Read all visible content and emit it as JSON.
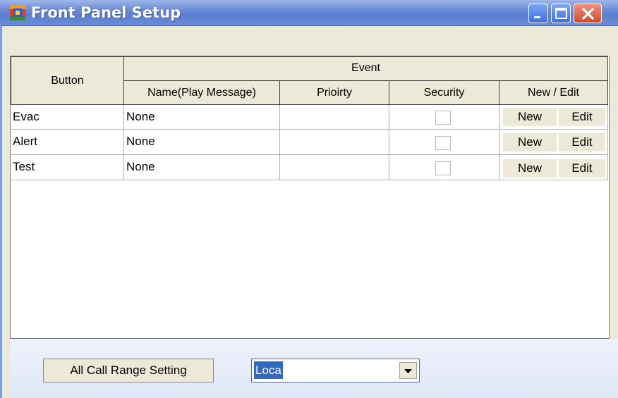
{
  "window": {
    "title": "Front Panel Setup",
    "icon": "app-icon",
    "controls": [
      "minimize-icon",
      "maximize-icon",
      "close-icon"
    ]
  },
  "table": {
    "header": {
      "button": "Button",
      "event": "Event",
      "name": "Name(Play Message)",
      "priority": "Prioirty",
      "security": "Security",
      "new_edit": "New / Edit"
    },
    "rows": [
      {
        "button": "Evac",
        "name": "None",
        "priority": "",
        "security_checked": false,
        "new_label": "New",
        "edit_label": "Edit"
      },
      {
        "button": "Alert",
        "name": "None",
        "priority": "",
        "security_checked": false,
        "new_label": "New",
        "edit_label": "Edit"
      },
      {
        "button": "Test",
        "name": "None",
        "priority": "",
        "security_checked": false,
        "new_label": "New",
        "edit_label": "Edit"
      }
    ]
  },
  "footer": {
    "all_call_button": "All Call Range Setting",
    "range_select_value": "Loca"
  },
  "colors": {
    "title_bar": "#6f8fd8",
    "header_bg": "#ece9d8",
    "selection": "#316ac5",
    "close_button": "#d24a2a"
  }
}
